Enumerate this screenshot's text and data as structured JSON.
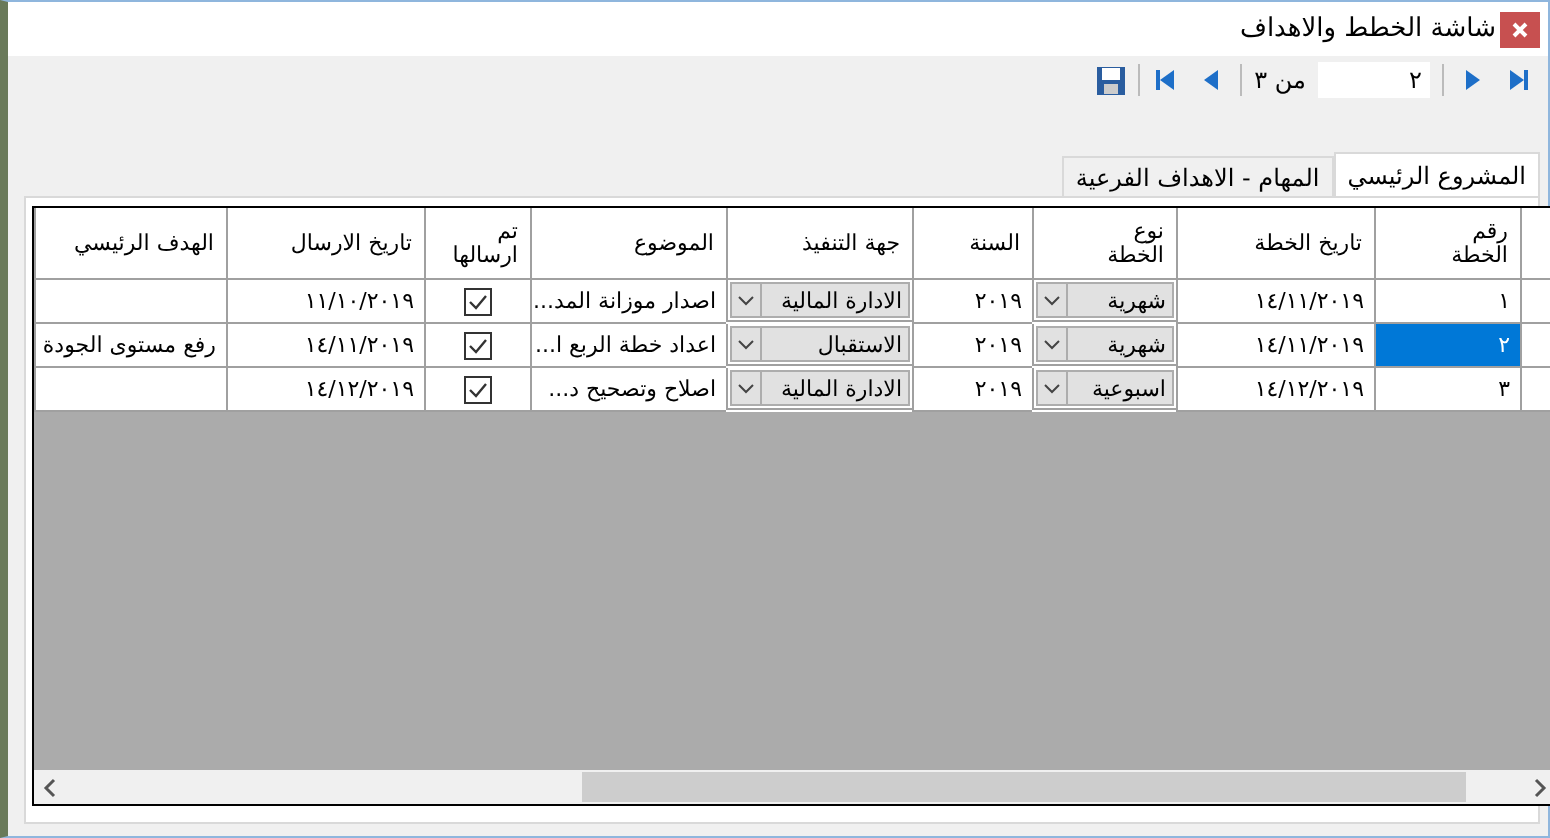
{
  "window": {
    "title": "شاشة الخطط والاهداف"
  },
  "toolbar": {
    "page_value": "٢",
    "page_total": "من ٣"
  },
  "tabs": [
    {
      "label": "المشروع الرئيسي",
      "selected": true
    },
    {
      "label": "المهام - الاهداف الفرعية",
      "selected": false
    }
  ],
  "table": {
    "columns": [
      "رقم\nالخطة",
      "تاريخ الخطة",
      "نوع\nالخطة",
      "السنة",
      "جهة التنفيذ",
      "الموضوع",
      "تم\nارسالها",
      "تاريخ الارسال",
      "الهدف الرئيسي"
    ],
    "rows": [
      {
        "selected": false,
        "number": "١",
        "plan_date": "١٤/١١/٢٠١٩",
        "plan_type": "شهرية",
        "year": "٢٠١٩",
        "executor": "الادارة المالية",
        "subject": "اصدار موزانة المد...",
        "sent": true,
        "sent_date": "١١/١٠/٢٠١٩"
      },
      {
        "selected": true,
        "number": "٢",
        "plan_date": "١٤/١١/٢٠١٩",
        "plan_type": "شهرية",
        "year": "٢٠١٩",
        "executor": "الاستقبال",
        "subject": "اعداد خطة الربع ا...",
        "sent": true,
        "sent_date": "١٤/١١/٢٠١٩",
        "goal": "رفع مستوى الجودة"
      },
      {
        "selected": false,
        "number": "٣",
        "plan_date": "١٤/١٢/٢٠١٩",
        "plan_type": "اسبوعية",
        "year": "٢٠١٩",
        "executor": "الادارة المالية",
        "subject": "اصلاح وتصحيح د...",
        "sent": true,
        "sent_date": "١٤/١٢/٢٠١٩"
      }
    ]
  }
}
